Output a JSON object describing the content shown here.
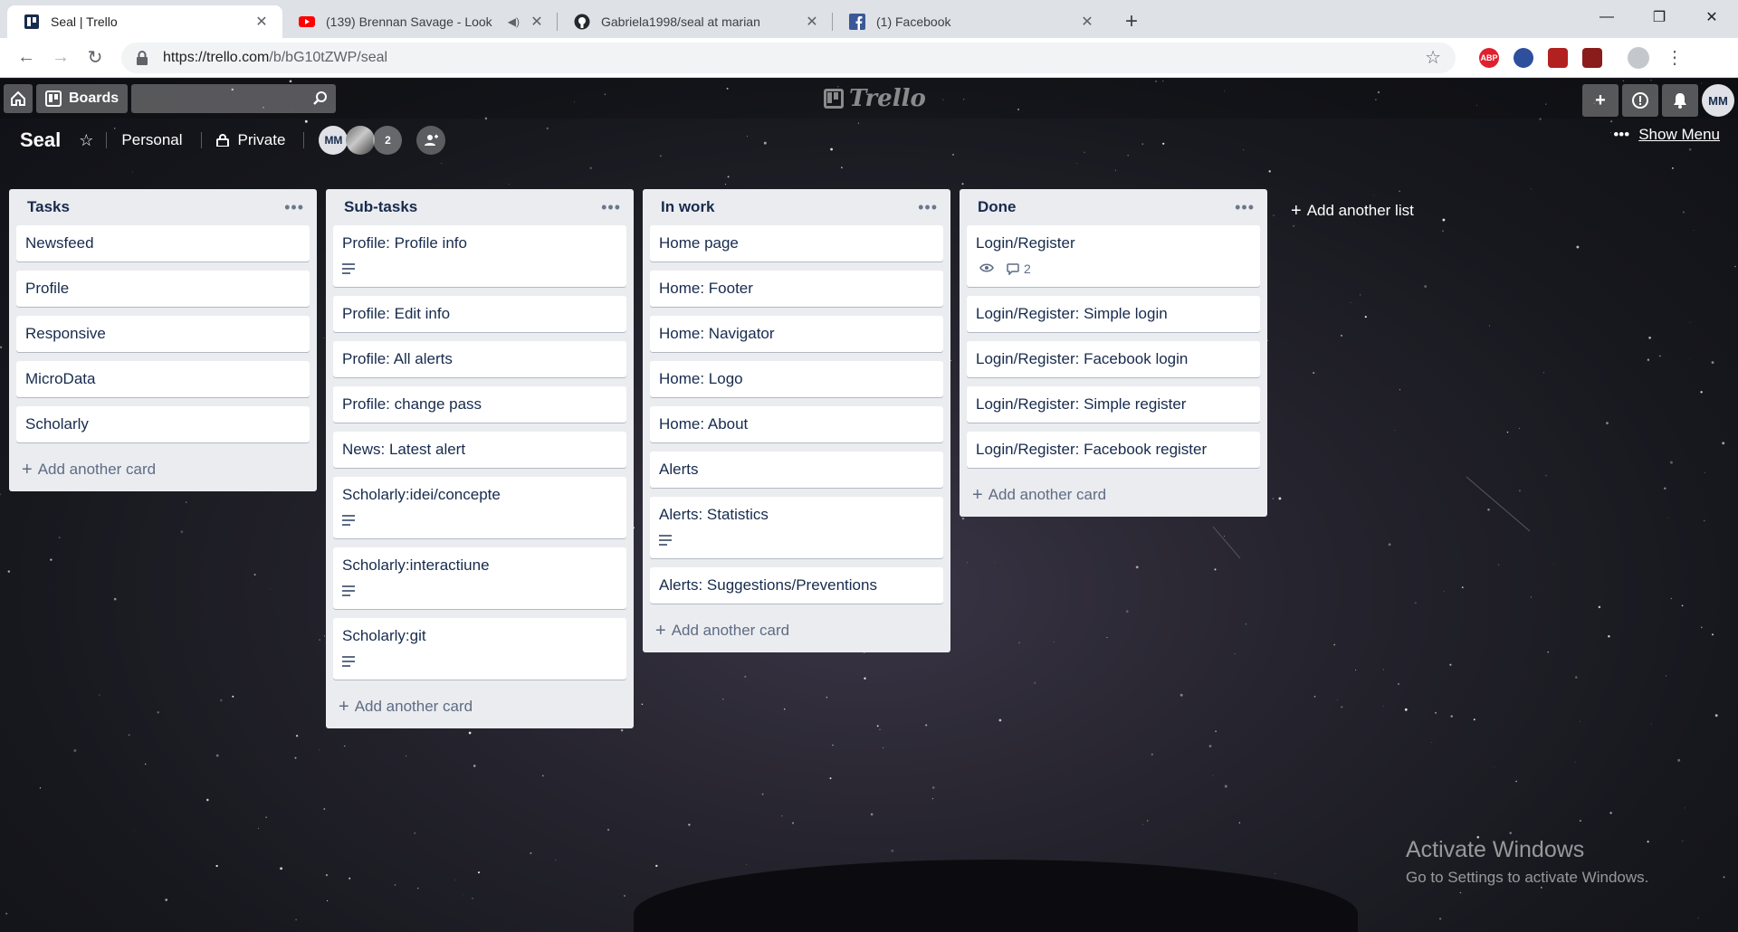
{
  "browser": {
    "tabs": [
      {
        "title": "Seal | Trello",
        "favicon": "trello-icon",
        "active": true
      },
      {
        "title": "(139) Brennan Savage - Look",
        "favicon": "youtube-icon",
        "active": false
      },
      {
        "title": "Gabriela1998/seal at marian",
        "favicon": "github-icon",
        "active": false
      },
      {
        "title": "(1) Facebook",
        "favicon": "facebook-icon",
        "active": false
      }
    ],
    "url_host": "https://trello.com",
    "url_path": "/b/bG10tZWP/seal",
    "extensions": [
      {
        "name": "adblock-icon",
        "label": "ABP",
        "color": "#e0202e"
      },
      {
        "name": "grammar-extension-icon",
        "label": "",
        "color": "#2d4f9e"
      },
      {
        "name": "screenshot-extension-icon",
        "label": "",
        "color": "#b32020"
      },
      {
        "name": "color-picker-extension-icon",
        "label": "",
        "color": "#8a1c1c"
      }
    ]
  },
  "header": {
    "boards_label": "Boards",
    "logo_text": "Trello",
    "user_initials": "MM"
  },
  "board": {
    "title": "Seal",
    "team_label": "Personal",
    "visibility_label": "Private",
    "members": {
      "initials": "MM",
      "extra_count": "2"
    },
    "show_menu_label": "Show Menu"
  },
  "lists": [
    {
      "title": "Tasks",
      "add_label": "Add another card",
      "cards": [
        {
          "title": "Newsfeed"
        },
        {
          "title": "Profile"
        },
        {
          "title": "Responsive"
        },
        {
          "title": "MicroData"
        },
        {
          "title": "Scholarly"
        }
      ]
    },
    {
      "title": "Sub-tasks",
      "add_label": "Add another card",
      "cards": [
        {
          "title": "Profile: Profile info",
          "description": true
        },
        {
          "title": "Profile: Edit info"
        },
        {
          "title": "Profile: All alerts"
        },
        {
          "title": "Profile: change pass"
        },
        {
          "title": "News: Latest alert"
        },
        {
          "title": "Scholarly:idei/concepte",
          "description": true
        },
        {
          "title": "Scholarly:interactiune",
          "description": true
        },
        {
          "title": "Scholarly:git",
          "description": true
        }
      ]
    },
    {
      "title": "In work",
      "add_label": "Add another card",
      "cards": [
        {
          "title": "Home page"
        },
        {
          "title": "Home: Footer"
        },
        {
          "title": "Home: Navigator"
        },
        {
          "title": "Home: Logo"
        },
        {
          "title": "Home: About"
        },
        {
          "title": "Alerts"
        },
        {
          "title": "Alerts: Statistics",
          "description": true
        },
        {
          "title": "Alerts: Suggestions/Preventions"
        }
      ]
    },
    {
      "title": "Done",
      "add_label": "Add another card",
      "cards": [
        {
          "title": "Login/Register",
          "watching": true,
          "comments": "2"
        },
        {
          "title": "Login/Register: Simple login"
        },
        {
          "title": "Login/Register: Facebook login"
        },
        {
          "title": "Login/Register: Simple register"
        },
        {
          "title": "Login/Register: Facebook register"
        }
      ]
    }
  ],
  "add_list_label": "Add another list",
  "watermark": {
    "line1": "Activate Windows",
    "line2": "Go to Settings to activate Windows."
  }
}
